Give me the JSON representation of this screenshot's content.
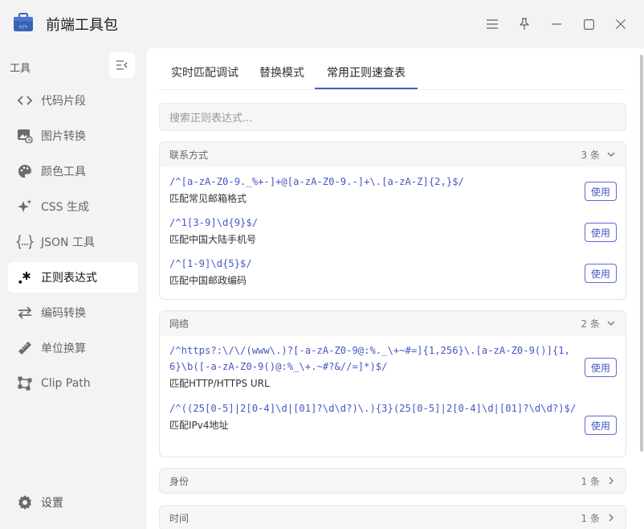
{
  "window": {
    "title": "前端工具包",
    "controls": [
      "menu-icon",
      "pin-icon",
      "minimize-icon",
      "maximize-icon",
      "close-icon"
    ]
  },
  "sidebar": {
    "heading": "工具",
    "items": [
      {
        "label": "代码片段",
        "icon": "code-icon"
      },
      {
        "label": "图片转换",
        "icon": "image-icon"
      },
      {
        "label": "颜色工具",
        "icon": "palette-icon"
      },
      {
        "label": "CSS 生成",
        "icon": "sparkle-icon"
      },
      {
        "label": "JSON 工具",
        "icon": "json-braces-icon"
      },
      {
        "label": "正则表达式",
        "icon": "regex-icon",
        "active": true
      },
      {
        "label": "编码转换",
        "icon": "swap-arrows-icon"
      },
      {
        "label": "单位换算",
        "icon": "ruler-icon"
      },
      {
        "label": "Clip Path",
        "icon": "clip-path-icon"
      }
    ],
    "settings_label": "设置"
  },
  "tabs": [
    "实时匹配调试",
    "替换模式",
    "常用正则速查表"
  ],
  "active_tab": 2,
  "search": {
    "placeholder": "搜索正则表达式..."
  },
  "groups": [
    {
      "name": "联系方式",
      "count": "3 条",
      "expanded": true,
      "entries": [
        {
          "pattern": "/^[a-zA-Z0-9._%+-]+@[a-zA-Z0-9.-]+\\.[a-zA-Z]{2,}$/",
          "desc": "匹配常见邮箱格式",
          "button": "使用"
        },
        {
          "pattern": "/^1[3-9]\\d{9}$/",
          "desc": "匹配中国大陆手机号",
          "button": "使用"
        },
        {
          "pattern": "/^[1-9]\\d{5}$/",
          "desc": "匹配中国邮政编码",
          "button": "使用"
        }
      ]
    },
    {
      "name": "网络",
      "count": "2 条",
      "expanded": true,
      "entries": [
        {
          "pattern": "/^https?:\\/\\/(www\\.)?[-a-zA-Z0-9@:%._\\+~#=]{1,256}\\.[a-zA-Z0-9()]{1,6}\\b([-a-zA-Z0-9()@:%_\\+.~#?&//=]*)$/",
          "desc": "匹配HTTP/HTTPS URL",
          "button": "使用"
        },
        {
          "pattern": "/^((25[0-5]|2[0-4]\\d|[01]?\\d\\d?)\\.){3}(25[0-5]|2[0-4]\\d|[01]?\\d\\d?)$/",
          "desc": "匹配IPv4地址",
          "button": "使用"
        }
      ]
    },
    {
      "name": "身份",
      "count": "1 条",
      "expanded": false
    },
    {
      "name": "时间",
      "count": "1 条",
      "expanded": false
    }
  ]
}
